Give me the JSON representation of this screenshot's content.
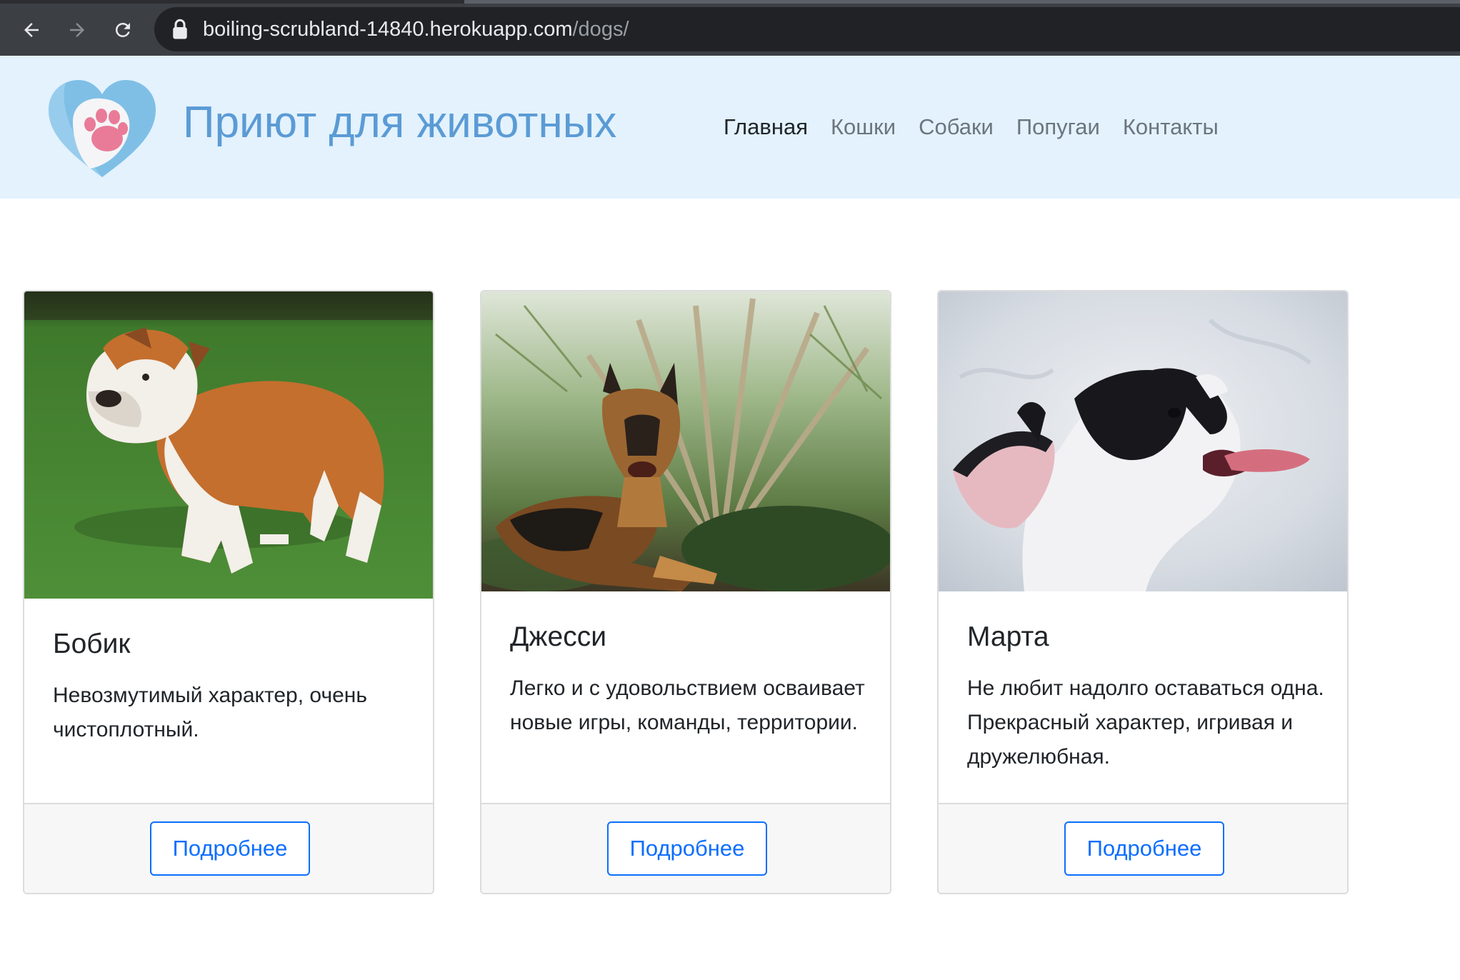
{
  "browser": {
    "url_host": "boiling-scrubland-14840.herokuapp.com",
    "url_path": "/dogs/",
    "icons": [
      "back-arrow-icon",
      "forward-arrow-icon",
      "reload-icon",
      "lock-icon"
    ]
  },
  "site": {
    "title": "Приют для животных",
    "logo_icon": "heart-paw-icon",
    "accent_color": "#5b9bd5",
    "header_bg": "#e3f2fd"
  },
  "nav": {
    "items": [
      {
        "label": "Главная",
        "active": true
      },
      {
        "label": "Кошки",
        "active": false
      },
      {
        "label": "Собаки",
        "active": false
      },
      {
        "label": "Попугаи",
        "active": false
      },
      {
        "label": "Контакты",
        "active": false
      }
    ]
  },
  "cards": [
    {
      "name": "Бобик",
      "description": "Невозмутимый характер, очень чистоплотный.",
      "button_label": "Подробнее",
      "image": "english-bulldog-photo"
    },
    {
      "name": "Джесси",
      "description": "Легко и с удовольствием осваивает новые игры, команды, территории.",
      "button_label": "Подробнее",
      "image": "german-shepherd-photo"
    },
    {
      "name": "Марта",
      "description": "Не любит надолго оставаться одна. Прекрасный характер, игривая и дружелюбная.",
      "button_label": "Подробнее",
      "image": "french-bulldog-photo"
    }
  ],
  "colors": {
    "button_primary": "#0d6efd",
    "card_footer_bg": "#f7f7f7",
    "nav_inactive": "#6c757d",
    "nav_active": "#212529"
  }
}
